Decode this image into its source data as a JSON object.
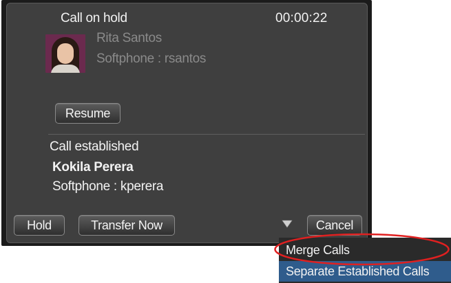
{
  "held_call": {
    "status": "Call on hold",
    "timer": "00:00:22",
    "contact_name": "Rita Santos",
    "contact_line": "Softphone  :  rsantos",
    "avatar_icon": "contact-photo",
    "resume_label": "Resume"
  },
  "established_call": {
    "status": "Call established",
    "contact_name": "Kokila Perera",
    "contact_line": "Softphone  :  kperera"
  },
  "toolbar": {
    "hold_label": "Hold",
    "transfer_label": "Transfer Now",
    "dropdown_icon": "triangle-down",
    "cancel_label": "Cancel"
  },
  "menu": {
    "items": [
      {
        "label": "Merge Calls"
      },
      {
        "label": "Separate Established Calls"
      }
    ]
  },
  "colors": {
    "panel_bg": "#3f3f3f",
    "panel_border": "#1b1b1b",
    "menu_bg": "#2a2a2a",
    "menu_selected": "#2f5c8c",
    "annotation": "#e02020"
  }
}
